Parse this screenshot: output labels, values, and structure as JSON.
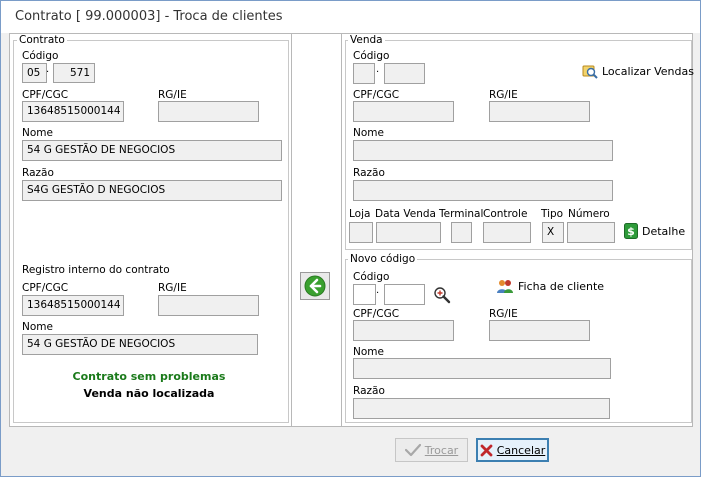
{
  "window": {
    "title": "Contrato [ 99.000003] - Troca de clientes"
  },
  "contrato": {
    "group_title": "Contrato",
    "codigo_label": "Código",
    "codigo_part1": "05",
    "codigo_part2": "571",
    "cpf_label": "CPF/CGC",
    "cpf_value": "13648515000144",
    "rg_label": "RG/IE",
    "rg_value": "",
    "nome_label": "Nome",
    "nome_value": "54 G GESTÃO DE NEGOCIOS",
    "razao_label": "Razão",
    "razao_value": "S4G GESTÃO D NEGOCIOS",
    "registro_title": "Registro interno do contrato",
    "reg_cpf_label": "CPF/CGC",
    "reg_cpf_value": "13648515000144",
    "reg_rg_label": "RG/IE",
    "reg_rg_value": "",
    "reg_nome_label": "Nome",
    "reg_nome_value": "54 G GESTÃO DE NEGOCIOS",
    "status_ok": "Contrato sem problemas",
    "status_venda": "Venda não localizada"
  },
  "venda": {
    "group_title": "Venda",
    "codigo_label": "Código",
    "codigo_part1": "",
    "codigo_part2": "",
    "localizar_label": "Localizar Vendas",
    "cpf_label": "CPF/CGC",
    "cpf_value": "",
    "rg_label": "RG/IE",
    "rg_value": "",
    "nome_label": "Nome",
    "nome_value": "",
    "razao_label": "Razão",
    "razao_value": "",
    "loja_label": "Loja",
    "data_label": "Data Venda",
    "terminal_label": "Terminal",
    "controle_label": "Controle",
    "tipo_label": "Tipo",
    "tipo_value": "X",
    "numero_label": "Número",
    "detalhe_label": "Detalhe"
  },
  "novo": {
    "group_title": "Novo código",
    "codigo_label": "Código",
    "ficha_label": "Ficha de cliente",
    "cpf_label": "CPF/CGC",
    "rg_label": "RG/IE",
    "nome_label": "Nome",
    "razao_label": "Razão"
  },
  "footer": {
    "trocar_label": "Trocar",
    "cancelar_label": "Cancelar"
  },
  "icons": {
    "transfer": "arrow-left-icon",
    "localizar": "search-folder-icon",
    "detalhe": "dollar-icon",
    "lupa": "magnifier-plus-icon",
    "ficha": "users-icon",
    "trocar": "check-icon",
    "cancelar": "x-icon"
  }
}
